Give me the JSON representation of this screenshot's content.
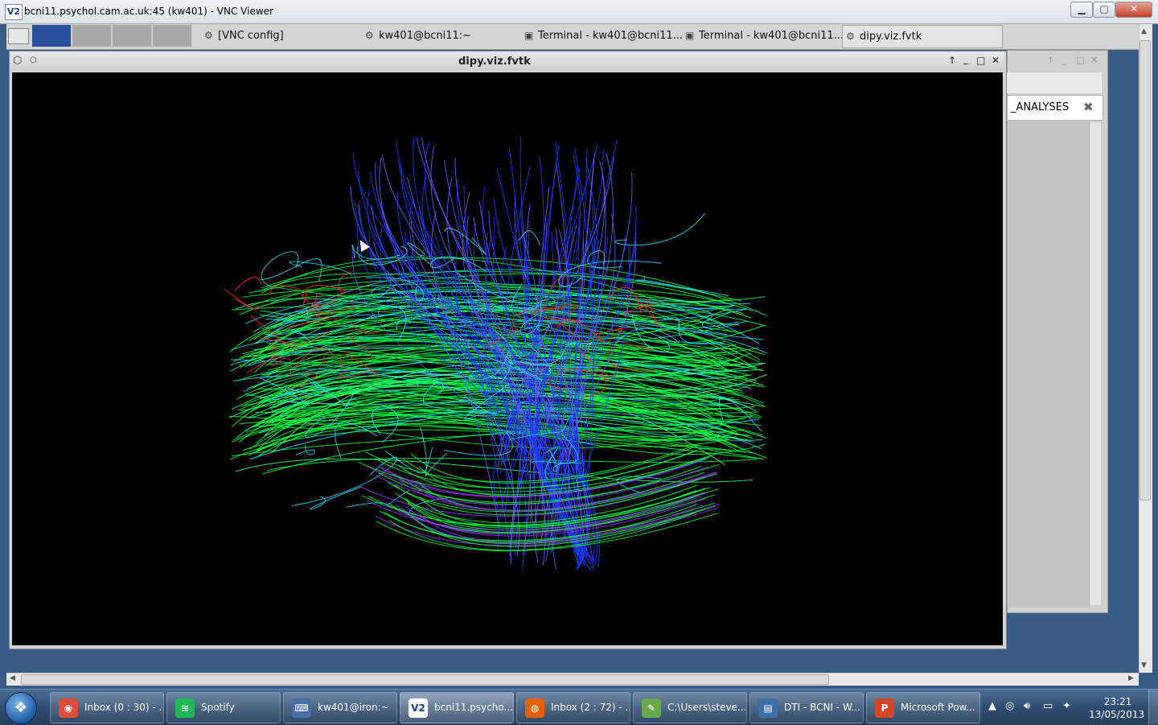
{
  "vnc": {
    "title": "bcni11.psychol.cam.ac.uk:45 (kw401) - VNC Viewer",
    "app_icon_text": "V2",
    "minimize": "▁",
    "maximize": "▢",
    "close": "✕"
  },
  "remote_panel": {
    "tasks": [
      {
        "label": "[VNC config]",
        "icon": "gear-icon"
      },
      {
        "label": "kw401@bcni11:~",
        "icon": "gear-icon"
      },
      {
        "label": "Terminal - kw401@bcni11...",
        "icon": "terminal-icon"
      },
      {
        "label": "Terminal - kw401@bcni11...",
        "icon": "terminal-icon"
      },
      {
        "label": "dipy.viz.fvtk",
        "icon": "gear-icon",
        "active": true
      }
    ]
  },
  "background_window": {
    "tab_label": "_ANALYSES",
    "tab_close": "✖"
  },
  "dipy_window": {
    "title": "dipy.viz.fvtk",
    "controls": [
      "↑",
      "_",
      "□",
      "✕"
    ]
  },
  "tractography": {
    "colors": [
      "#00ff40",
      "#2ad8ff",
      "#1a3cff",
      "#ff2a2a",
      "#6a5cff",
      "#40ff90",
      "#9a30ff"
    ]
  },
  "taskbar": {
    "items": [
      {
        "label": "Inbox (0 : 30) - ...",
        "icon": "chrome-icon",
        "color": "#dd4b39"
      },
      {
        "label": "Spotify",
        "icon": "spotify-icon",
        "color": "#1db954"
      },
      {
        "label": "kw401@iron:~",
        "icon": "putty-icon",
        "color": "#4a6fa5"
      },
      {
        "label": "bcni11.psycho...",
        "icon": "vnc-icon",
        "color": "#ffffff",
        "active": true
      },
      {
        "label": "Inbox (2 : 72) - ...",
        "icon": "firefox-icon",
        "color": "#e66000"
      },
      {
        "label": "C:\\Users\\steve...",
        "icon": "notepad-icon",
        "color": "#6aa84f"
      },
      {
        "label": "DTI - BCNI - W...",
        "icon": "remote-desktop-icon",
        "color": "#3d6ea8"
      },
      {
        "label": "Microsoft Pow...",
        "icon": "powerpoint-icon",
        "color": "#d24726"
      }
    ],
    "clock_time": "23:21",
    "clock_date": "13/05/2013"
  }
}
